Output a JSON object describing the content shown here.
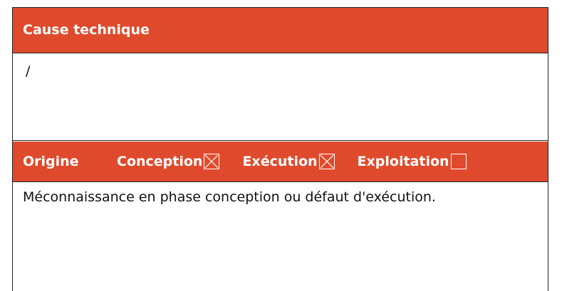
{
  "cause": {
    "title": "Cause technique",
    "value": "/"
  },
  "origine": {
    "label": "Origine",
    "options": [
      {
        "label": "Conception",
        "checked": true
      },
      {
        "label": "Exécution",
        "checked": true
      },
      {
        "label": "Exploitation",
        "checked": false
      }
    ],
    "description": "Méconnaissance en phase conception ou défaut d'exécution."
  },
  "colors": {
    "header_bg": "#e04a2c",
    "header_text": "#ffffff",
    "border": "#222222"
  }
}
